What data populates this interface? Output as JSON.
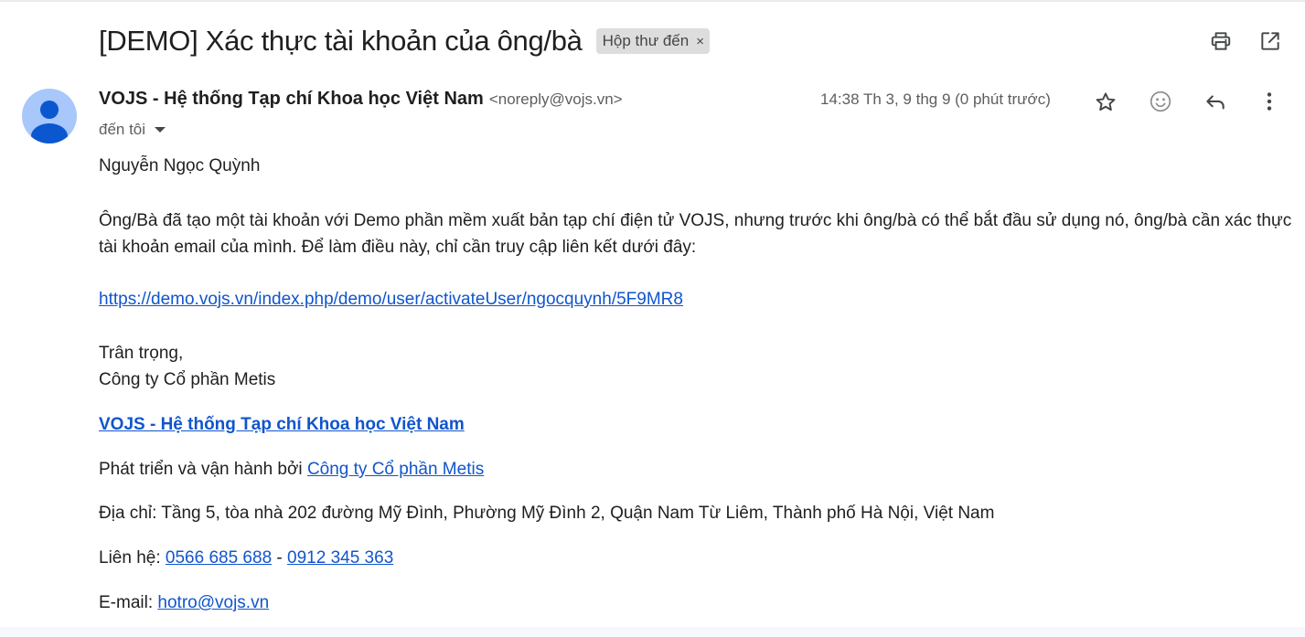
{
  "email": {
    "subject": "[DEMO] Xác thực tài khoản của ông/bà",
    "label": "Hộp thư đến",
    "label_remove": "×",
    "sender_name": "VOJS - Hệ thống Tạp chí Khoa học Việt Nam",
    "sender_email": "<noreply@vojs.vn>",
    "recipient": "đến tôi",
    "date": "14:38 Th 3, 9 thg 9 (0 phút trước)"
  },
  "icons": {
    "print": "print-icon",
    "open_new_window": "open-in-new-window-icon",
    "star": "star-icon",
    "emoji": "emoji-reaction-icon",
    "reply": "reply-icon",
    "more": "more-vertical-icon",
    "avatar": "default-avatar-icon",
    "caret": "chevron-down-icon"
  },
  "body": {
    "greeting": "Nguyễn Ngọc Quỳnh",
    "paragraph": "Ông/Bà đã tạo một tài khoản với Demo phần mềm xuất bản tạp chí điện tử VOJS, nhưng trước khi ông/bà có thể bắt đầu sử dụng nó, ông/bà cần xác thực tài khoản email của mình. Để làm điều này, chỉ cần truy cập liên kết dưới đây:",
    "activation_link": "https://demo.vojs.vn/index.php/demo/user/activateUser/ngocquynh/5F9MR8",
    "closing": "Trân trọng,",
    "company": "Công ty Cổ phần Metis",
    "brand_link": "VOJS - Hệ thống Tạp chí Khoa học Việt Nam",
    "developed_by_prefix": "Phát triển và vận hành bởi ",
    "developed_by_link": "Công ty Cổ phần Metis",
    "address": "Địa chỉ: Tầng 5, tòa nhà 202 đường Mỹ Đình, Phường Mỹ Đình 2, Quận Nam Từ Liêm, Thành phố Hà Nội, Việt Nam",
    "contact_prefix": "Liên hệ: ",
    "phone1": "0566 685 688",
    "contact_separator": " - ",
    "phone2": "0912 345 363",
    "email_prefix": "E-mail: ",
    "support_email": "hotro@vojs.vn"
  },
  "colors": {
    "link": "#1155cc",
    "chip_bg": "#dddddd",
    "avatar_bg": "#a8c7fa",
    "avatar_fg": "#0b57d0"
  }
}
